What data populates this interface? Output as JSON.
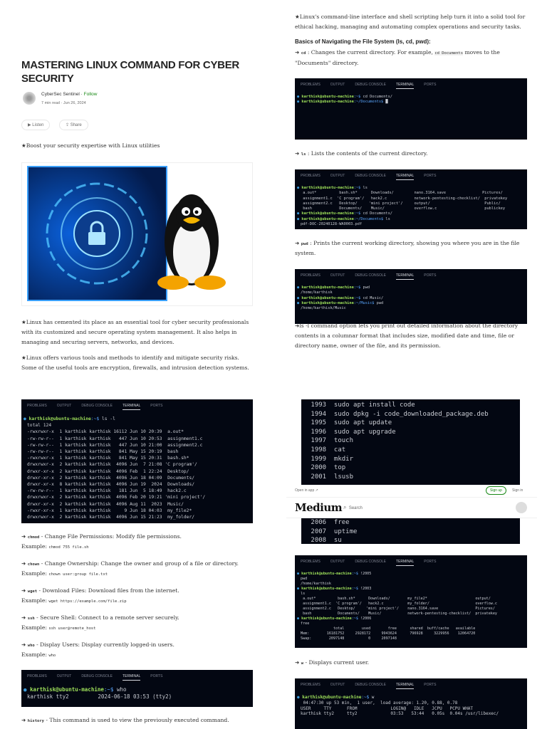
{
  "article": {
    "title": "MASTERING LINUX COMMAND FOR CYBER SECURITY",
    "author": "CyberSec Sentinel",
    "follow": "Follow",
    "read_time": "7 min read",
    "date": "Jun 26, 2024",
    "sep": "·",
    "listen": "Listen",
    "share": "Share",
    "intro": "★Boost your security expertise with Linux utilities",
    "para1": "★Linux has cemented its place as an essential tool for cyber security professionals with its customized and secure operating system management. It also helps in managing and securing servers, networks, and devices.",
    "para2": "★Linux offers various tools and methods to identify and mitigate security risks. Some of the useful tools are encryption, firewalls, and intrusion detection systems.",
    "para3": "★Linux's command-line interface and shell scripting help turn it into a solid tool for ethical hacking, managing and automating complex operations and security tasks.",
    "heading": "Basics of Navigating the File System (ls, cd, pwd):",
    "cd": {
      "arrow": "➜",
      "cmd": "cd",
      "text1": " : Changes the current directory. For example, ",
      "code": "cd Documents",
      "text2": " moves to the \"Documents\" directory."
    },
    "ls": {
      "arrow": "➜",
      "cmd": "ls",
      "text": " : Lists the contents of the current directory."
    },
    "pwd": {
      "arrow": "➜",
      "cmd": "pwd",
      "text": " : Prints the current working directory, showing you where you are in the file system."
    },
    "lsl": "➜ls -l command option lets you print out detailed information about the directory contents in a columnar format that includes size, modified date and time, file or directory name, owner of the file, and its permission.",
    "commands": [
      {
        "arrow": "➜",
        "cmd": "chmod",
        "desc": " - Change File Permissions: Modify file permissions.",
        "ex_label": "Example: ",
        "ex": "chmod 755 file.sh"
      },
      {
        "arrow": "➜",
        "cmd": "chown",
        "desc": " - Change Ownership: Change the owner and group of a file or directory.",
        "ex_label": "Example: ",
        "ex": "chown user:group file.txt"
      },
      {
        "arrow": "➜",
        "cmd": "wget",
        "desc": " - Download Files: Download files from the internet.",
        "ex_label": "Example: ",
        "ex": "wget https://example.com/file.zip"
      },
      {
        "arrow": "➜",
        "cmd": "ssh",
        "desc": " - Secure Shell: Connect to a remote server securely.",
        "ex_label": "Example: ",
        "ex": "ssh user@remote_host"
      },
      {
        "arrow": "➜",
        "cmd": "who",
        "desc": " - Display Users: Display currently logged-in users.",
        "ex_label": "Example: ",
        "ex": "who"
      }
    ],
    "history": {
      "arrow": "➜",
      "cmd": "history",
      "desc": " - This command is used to view the previously executed command."
    },
    "w": {
      "arrow": "➜",
      "cmd": "w",
      "desc": " - Displays current user."
    }
  },
  "medium": {
    "open_in_app": "Open in app ↗",
    "sign_up": "Sign up",
    "sign_in": "Sign in",
    "logo": "Medium",
    "search": "Search"
  },
  "terminal_tabs": [
    "PROBLEMS",
    "OUTPUT",
    "DEBUG CONSOLE",
    "TERMINAL",
    "PORTS"
  ],
  "terminals": {
    "cd": [
      {
        "u": "karthisk@ubuntu-machine",
        "p": ":~$",
        "c": " cd Documents/"
      },
      {
        "u": "karthisk@ubuntu-machine",
        "p": ":~/Documents$",
        "c": " █"
      }
    ],
    "ls": [
      {
        "u": "karthisk@ubuntu-machine",
        "p": ":~$",
        "c": " ls"
      },
      {
        "t": " a.out*          bash.sh*      Downloads/         nano.3164.save                Pictures/"
      },
      {
        "t": " assignment1.c  'C program'/   hack2.c            network-pentesting-checklist/  privatekey"
      },
      {
        "t": " assignment2.c   Desktop/     'mini project'/     output/                        Public/"
      },
      {
        "t": " bash            Documents/    Music/             overflow.c                     publickey"
      },
      {
        "u": "karthisk@ubuntu-machine",
        "p": ":~$",
        "c": " cd Documents/"
      },
      {
        "u": "karthisk@ubuntu-machine",
        "p": ":~/Documents$",
        "c": " ls"
      },
      {
        "t": "pdf-DOC-20240128-WA0003.pdf"
      }
    ],
    "pwd": [
      {
        "u": "karthisk@ubuntu-machine",
        "p": ":~$",
        "c": " pwd"
      },
      {
        "t": "/home/karthisk"
      },
      {
        "u": "karthisk@ubuntu-machine",
        "p": ":~$",
        "c": " cd Music/"
      },
      {
        "u": "karthisk@ubuntu-machine",
        "p": ":~/Music$",
        "c": " pwd"
      },
      {
        "t": "/home/karthisk/Music"
      }
    ],
    "lsl": [
      {
        "u": "karthisk@ubuntu-machine",
        "p": ":~$",
        "c": " ls -l"
      },
      {
        "t": "total 124"
      },
      {
        "t": "-rwxrwxr-x  1 karthisk karthisk 16112 Jun 10 20:39  a.out*"
      },
      {
        "t": "-rw-rw-r--  1 karthisk karthisk   447 Jun 10 20:53  assignment1.c"
      },
      {
        "t": "-rw-rw-r--  1 karthisk karthisk   447 Jun 10 21:00  assignment2.c"
      },
      {
        "t": "-rw-rw-r--  1 karthisk karthisk   841 May 15 20:19  bash"
      },
      {
        "t": "-rwxrwxr-x  1 karthisk karthisk   841 May 15 20:31  bash.sh*"
      },
      {
        "t": "drwxrwxr-x  2 karthisk karthisk  4096 Jun  7 21:08 'C program'/"
      },
      {
        "t": "drwxr-xr-x  2 karthisk karthisk  4096 Feb  1 22:24  Desktop/"
      },
      {
        "t": "drwxr-xr-x  2 karthisk karthisk  4096 Jun 18 04:09  Documents/"
      },
      {
        "t": "drwxr-xr-x  8 karthisk karthisk  4096 Jun 19  2024  Downloads/"
      },
      {
        "t": "-rw-rw-r--  1 karthisk karthisk   181 Jun  5 18:49  hack2.c"
      },
      {
        "t": "drwxrwxr-x  2 karthisk karthisk  4096 Feb 20 19:21 'mini project'/"
      },
      {
        "t": "drwxr-xr-x  2 karthisk karthisk  4096 Aug 11  2023  Music/"
      },
      {
        "t": "-rwxr-xr-x  1 karthisk karthisk     9 Jun 18 04:03  my_file2*"
      },
      {
        "t": "drwxrwxr-x  2 karthisk karthisk  4096 Jun 15 21:23  my_folder/"
      }
    ],
    "who": [
      {
        "u": "karthisk@ubuntu-machine",
        "p": ":~$",
        "c": " who"
      },
      {
        "t": "karthisk tty2         2024-06-18 03:53 (tty2)"
      }
    ],
    "history_top": [
      {
        "t": " 1993  sudo apt install code"
      },
      {
        "t": " 1994  sudo dpkg -i code_downloaded_package.deb"
      },
      {
        "t": " 1995  sudo apt update"
      },
      {
        "t": " 1996  sudo apt upgrade"
      },
      {
        "t": " 1997  touch"
      },
      {
        "t": " 1998  cat"
      },
      {
        "t": " 1999  mkdir"
      },
      {
        "t": " 2000  top"
      },
      {
        "t": " 2001  lsusb"
      }
    ],
    "history_bottom": [
      {
        "t": " 2006  free"
      },
      {
        "t": " 2007  uptime"
      },
      {
        "t": " 2008  su"
      }
    ],
    "free": [
      {
        "u": "karthisk@ubuntu-machine",
        "p": ":~$",
        "c": " !2005"
      },
      {
        "t": "pwd"
      },
      {
        "t": "/home/karthisk"
      },
      {
        "u": "karthisk@ubuntu-machine",
        "p": ":~$",
        "c": " !2003"
      },
      {
        "t": "ls"
      },
      {
        "t": " a.out*          bash.sh*      Downloads/        my_file2*                      output/"
      },
      {
        "t": " assignment1.c  'C program'/   hack2.c           my_folder/                     overflow.c"
      },
      {
        "t": " assignment2.c   Desktop/     'mini project'/    nano.3164.save                 Pictures/"
      },
      {
        "t": " bash            Documents/    Music/            network-pentesting-checklist/  privatekey"
      },
      {
        "u": "karthisk@ubuntu-machine",
        "p": ":~$",
        "c": " !2006"
      },
      {
        "t": "free"
      },
      {
        "t": "               total        used        free      shared  buff/cache   available"
      },
      {
        "t": "Mem:        16181752     2928172     9943624      796928     3229956    12064720"
      },
      {
        "t": "Swap:        2097148           0     2097148"
      }
    ],
    "w": [
      {
        "u": "karthisk@ubuntu-machine",
        "p": ":~$",
        "c": " w"
      },
      {
        "t": " 04:47:30 up 53 min,  1 user,  load average: 1.20, 0.88, 0.78"
      },
      {
        "t": "USER     TTY      FROM             LOGIN@   IDLE   JCPU   PCPU WHAT"
      },
      {
        "t": "karthisk tty2     tty2             03:53   53:44   0.05s  0.04s /usr/libexec/"
      }
    ]
  }
}
